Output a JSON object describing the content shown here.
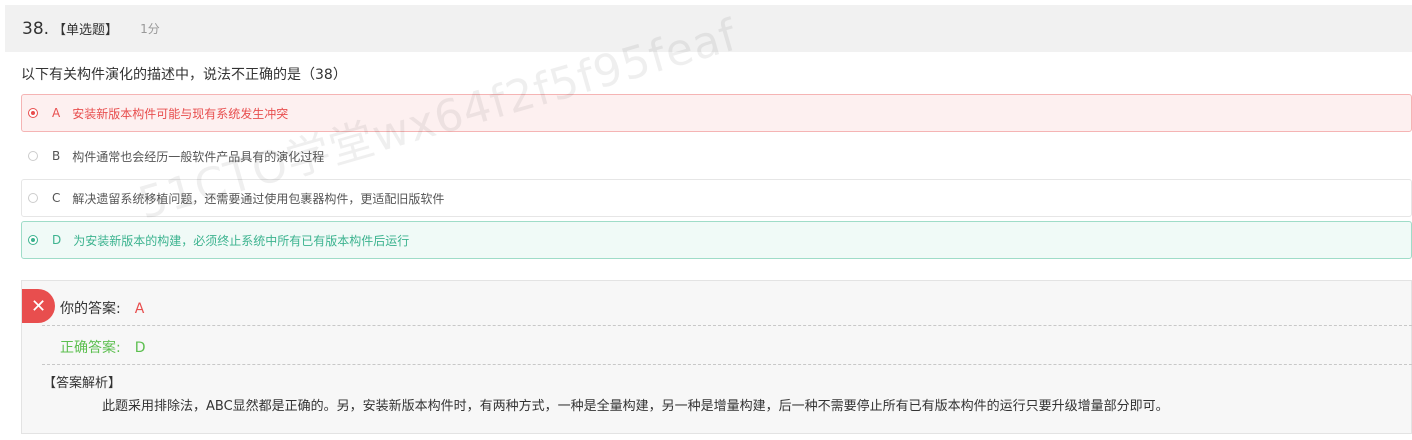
{
  "question": {
    "number": "38.",
    "type": "【单选题】",
    "score": "1分",
    "stem": "以下有关构件演化的描述中，说法不正确的是（38）"
  },
  "options": [
    {
      "letter": "A",
      "text": "安装新版本构件可能与现有系统发生冲突",
      "state": "wrong-selected"
    },
    {
      "letter": "B",
      "text": "构件通常也会经历一般软件产品具有的演化过程",
      "state": "normal"
    },
    {
      "letter": "C",
      "text": "解决遗留系统移植问题，还需要通过使用包裹器构件，更适配旧版软件",
      "state": "normal"
    },
    {
      "letter": "D",
      "text": "为安装新版本的构建，必须终止系统中所有已有版本构件后运行",
      "state": "correct"
    }
  ],
  "result": {
    "your_label": "你的答案:",
    "your_value": "A",
    "correct_label": "正确答案:",
    "correct_value": "D",
    "status_icon": "close-icon"
  },
  "analysis": {
    "title": "【答案解析】",
    "body": "此题采用排除法，ABC显然都是正确的。另，安装新版本构件时，有两种方式，一种是全量构建，另一种是增量构建，后一种不需要停止所有已有版本构件的运行只要升级增量部分即可。"
  },
  "watermark": "51CTO学堂wx64f2f5f95feaf",
  "colors": {
    "wrong": "#e84e4e",
    "correct": "#3cb38f",
    "correct_answer_text": "#5cbf4f",
    "header_bg": "#f1f1f1"
  }
}
